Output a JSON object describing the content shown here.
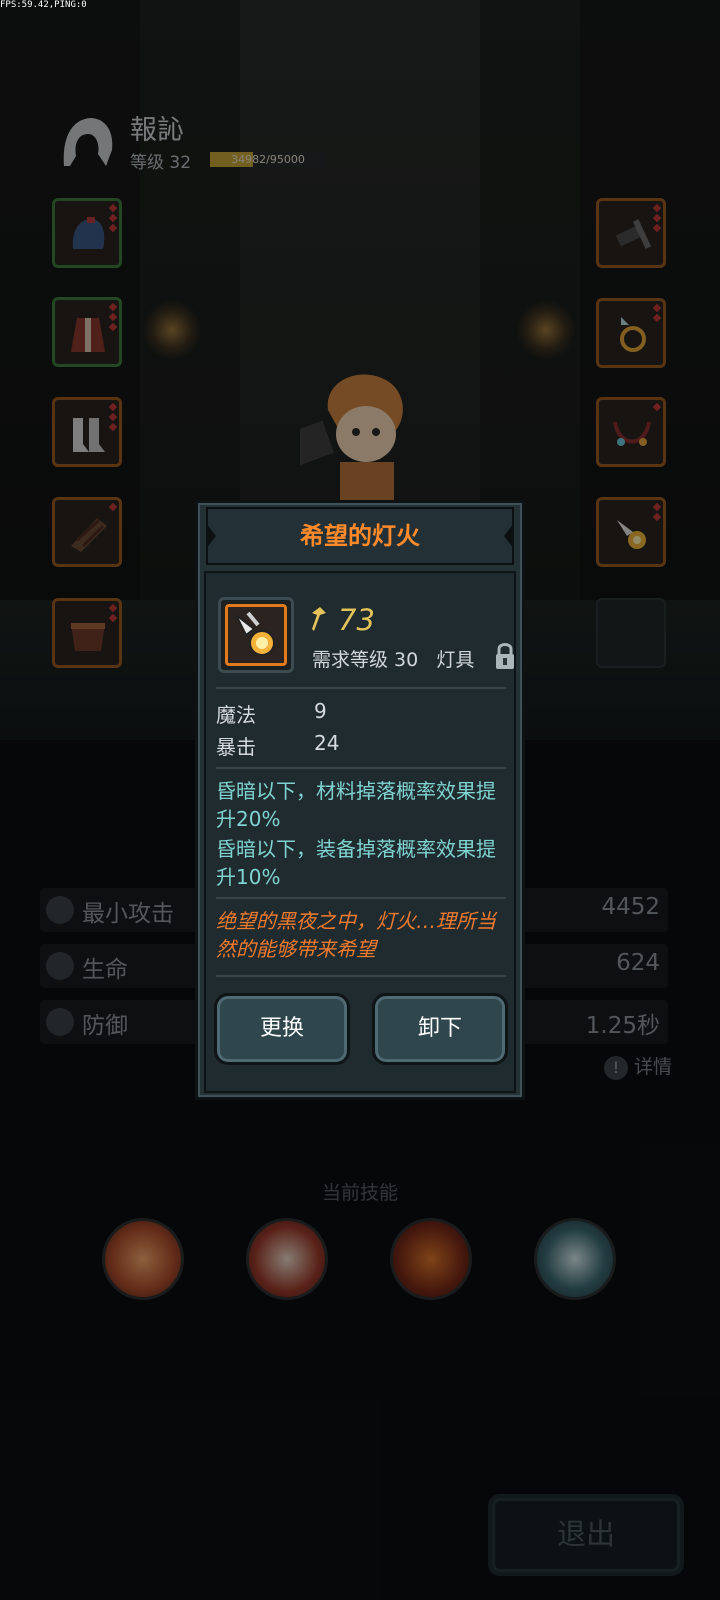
{
  "debug": {
    "fps_text": "FPS:59.42,PING:0"
  },
  "player": {
    "name": "報訫",
    "level_label": "等级 32",
    "xp_text": "34982/95000",
    "xp_fraction": 0.368
  },
  "stats": [
    {
      "label": "最小攻击",
      "value": "4452",
      "icon": "sword-icon"
    },
    {
      "label": "生命",
      "value": "624",
      "icon": "heart-icon"
    },
    {
      "label": "防御",
      "value": "1.25秒",
      "icon": "shield-icon"
    }
  ],
  "details_label": "详情",
  "skills_title": "当前技能",
  "exit_label": "退出",
  "item": {
    "name": "希望的灯火",
    "power": "73",
    "requirement": "需求等级 30",
    "type": "灯具",
    "attributes": [
      {
        "name": "魔法",
        "value": "9"
      },
      {
        "name": "暴击",
        "value": "24"
      }
    ],
    "effects": [
      "昏暗以下，材料掉落概率效果提升20%",
      "昏暗以下，装备掉落概率效果提升10%"
    ],
    "flavor": "绝望的黑夜之中，灯火…理所当然的能够带来希望",
    "buttons": {
      "replace": "更换",
      "unequip": "卸下"
    }
  },
  "colors": {
    "title_orange": "#ff8a2a",
    "power_gold": "#e3c35a",
    "effect_cyan": "#7fd3d0",
    "flavor_orange": "#ef7a2d"
  }
}
